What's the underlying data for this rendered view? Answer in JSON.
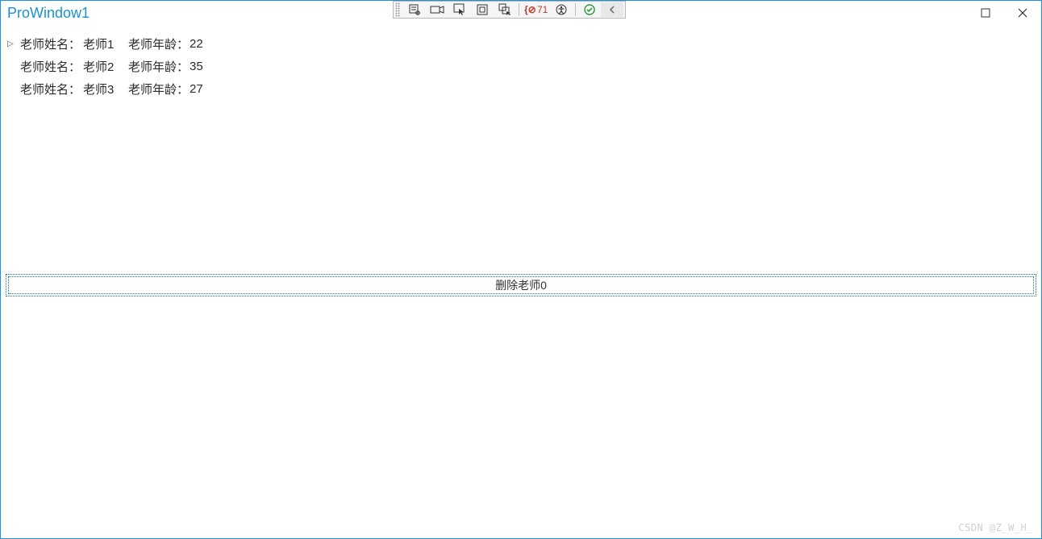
{
  "window": {
    "title": "ProWindow1"
  },
  "debug_toolbar": {
    "target_count": "71"
  },
  "labels": {
    "teacher_name": "老师姓名：",
    "teacher_age": "老师年龄："
  },
  "teachers": [
    {
      "name": "老师1",
      "age": "22"
    },
    {
      "name": "老师2",
      "age": "35"
    },
    {
      "name": "老师3",
      "age": "27"
    }
  ],
  "buttons": {
    "delete_teacher": "删除老师0"
  },
  "watermark": "CSDN @Z_W_H_"
}
